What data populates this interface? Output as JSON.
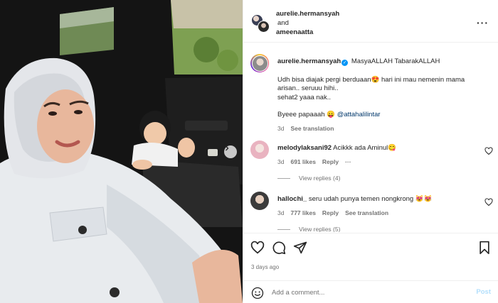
{
  "header": {
    "owner_1": "aurelie.hermansyah",
    "and_text": "and",
    "owner_2": "ameenaatta",
    "more_icon": "more-horizontal-icon"
  },
  "caption": {
    "username": "aurelie.hermansyah",
    "line_1": "MasyaALLAH TabarakALLAH",
    "line_2a": "Udh bisa diajak pergi berduaan",
    "emoji_2": "😍",
    "line_2b": " hari ini mau nemenin mama",
    "line_3": "arisan.. seruuu hihi..",
    "line_4": "sehat2 yaaa nak..",
    "line_5a": "Byeee papaaah ",
    "emoji_5": "😛",
    "mention": "@attahalilintar",
    "time": "3d",
    "see_translation": "See translation"
  },
  "comments": [
    {
      "username": "melodylaksani92",
      "text": "Acikkk ada Aminul",
      "emoji": "😋",
      "time": "3d",
      "likes": "691 likes",
      "reply": "Reply",
      "view_replies": "View replies (4)",
      "avatar_color": "#e9b3c0"
    },
    {
      "username": "hallochi_",
      "text": "seru udah punya temen nongkrong ",
      "emoji": "😻😻",
      "time": "3d",
      "likes": "777 likes",
      "reply": "Reply",
      "see_translation": "See translation",
      "view_replies": "View replies (5)",
      "avatar_color": "#3b3b3b"
    }
  ],
  "actions": {
    "posted_ago": "3 days ago",
    "add_comment_placeholder": "Add a comment...",
    "post_label": "Post"
  },
  "colors": {
    "accent_blue": "#0095f6",
    "post_disabled": "#b2dffc",
    "muted_text": "#737373"
  }
}
